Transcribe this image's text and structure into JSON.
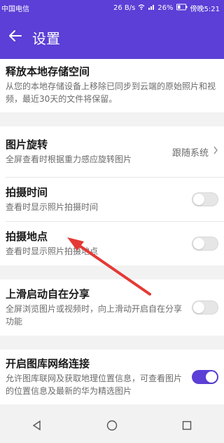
{
  "status": {
    "carrier": "中国电信",
    "speed": "26 B/s",
    "battery": "26%",
    "time": "傍晚5:21"
  },
  "header": {
    "title": "设置"
  },
  "settings": {
    "free_space": {
      "title": "释放本地存储空间",
      "subtitle": "从您的本地存储设备上移除已同步到云端的原始照片和视频，最近30天的文件将保留。"
    },
    "rotate": {
      "title": "图片旋转",
      "subtitle": "全屏查看时根据重力感应旋转图片",
      "value": "跟随系统"
    },
    "shoot_time": {
      "title": "拍摄时间",
      "subtitle": "查看时显示照片拍摄时间",
      "enabled": false
    },
    "shoot_location": {
      "title": "拍摄地点",
      "subtitle": "查看时显示照片拍摄地点",
      "enabled": false
    },
    "swipe_share": {
      "title": "上滑启动自在分享",
      "subtitle": "全屏浏览图片或视频时，向上滑动开启自在分享功能",
      "enabled": false
    },
    "network": {
      "title": "开启图库网络连接",
      "subtitle": "允许图库联网及获取地理位置信息，可查看图片的位置信息及最新的华为精选图片",
      "enabled": true
    }
  },
  "colors": {
    "accent": "#5b3fd6",
    "annotation": "#e53935"
  },
  "icons": {
    "back": "arrow-left-icon",
    "nav_back": "triangle-back-icon",
    "nav_home": "circle-home-icon",
    "nav_recent": "square-recent-icon"
  }
}
